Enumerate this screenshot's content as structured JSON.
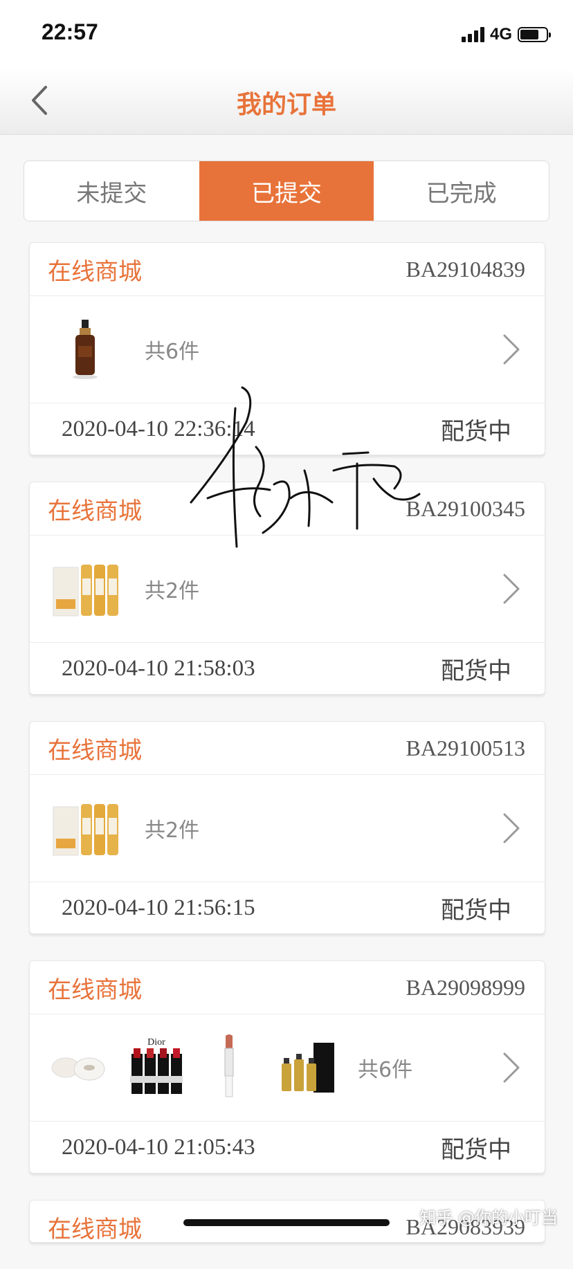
{
  "status_bar": {
    "time": "22:57",
    "network": "4G"
  },
  "nav": {
    "title": "我的订单"
  },
  "tabs": [
    {
      "label": "未提交",
      "active": false
    },
    {
      "label": "已提交",
      "active": true
    },
    {
      "label": "已完成",
      "active": false
    }
  ],
  "orders": [
    {
      "shop": "在线商城",
      "order_no": "BA29104839",
      "count": "共6件",
      "time": "2020-04-10 22:36:14",
      "status": "配货中",
      "thumbs": [
        "serum-bottle-image"
      ]
    },
    {
      "shop": "在线商城",
      "order_no": "BA29100345",
      "count": "共2件",
      "time": "2020-04-10 21:58:03",
      "status": "配货中",
      "thumbs": [
        "toner-set-image"
      ]
    },
    {
      "shop": "在线商城",
      "order_no": "BA29100513",
      "count": "共2件",
      "time": "2020-04-10 21:56:15",
      "status": "配货中",
      "thumbs": [
        "toner-set-image"
      ]
    },
    {
      "shop": "在线商城",
      "order_no": "BA29098999",
      "count": "共6件",
      "time": "2020-04-10 21:05:43",
      "status": "配货中",
      "thumbs": [
        "cushion-compact-image",
        "lipstick-set-image",
        "lipstick-image",
        "serum-set-image"
      ],
      "lipstick_brand": "Dior"
    },
    {
      "shop": "在线商城",
      "order_no": "BA29083939"
    }
  ],
  "watermark": "知乎 @你的小叮当",
  "colors": {
    "accent": "#e8733a",
    "text": "#444444",
    "muted": "#888888"
  }
}
